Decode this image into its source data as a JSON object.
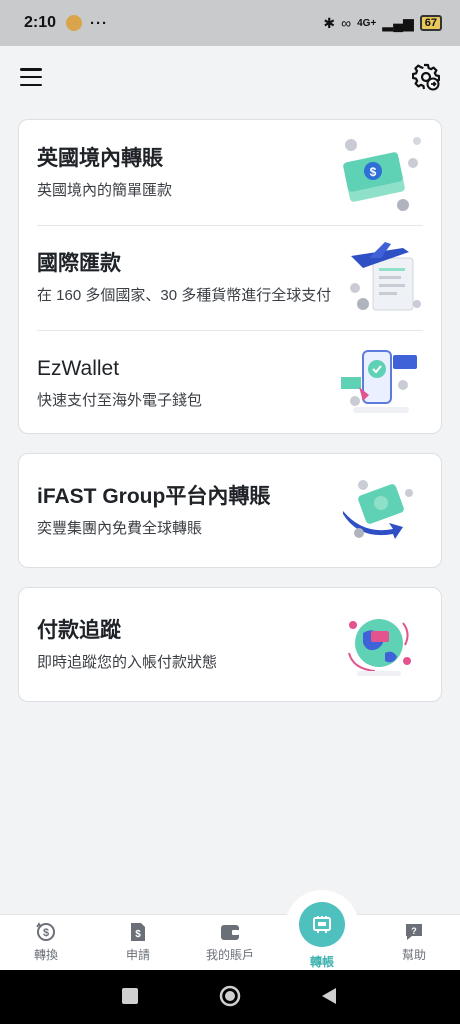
{
  "status_bar": {
    "time": "2:10",
    "dots": "···",
    "network": "4G+",
    "battery": "67"
  },
  "cards": [
    {
      "rows": [
        {
          "title": "英國境內轉賬",
          "subtitle": "英國境內的簡單匯款"
        },
        {
          "title": "國際匯款",
          "subtitle": "在 160 多個國家、30 多種貨幣進行全球支付"
        },
        {
          "title": "EzWallet",
          "subtitle": "快速支付至海外電子錢包"
        }
      ]
    },
    {
      "rows": [
        {
          "title": "iFAST Group平台內轉賬",
          "subtitle": "奕豐集團內免費全球轉賬"
        }
      ]
    },
    {
      "rows": [
        {
          "title": "付款追蹤",
          "subtitle": "即時追蹤您的入帳付款狀態"
        }
      ]
    }
  ],
  "bottom_nav": [
    {
      "label": "轉換"
    },
    {
      "label": "申請"
    },
    {
      "label": "我的賬戶"
    },
    {
      "label": "轉帳",
      "active": true
    },
    {
      "label": "幫助"
    }
  ],
  "colors": {
    "accent": "#4ec0bd",
    "background": "#f2f3f5"
  }
}
